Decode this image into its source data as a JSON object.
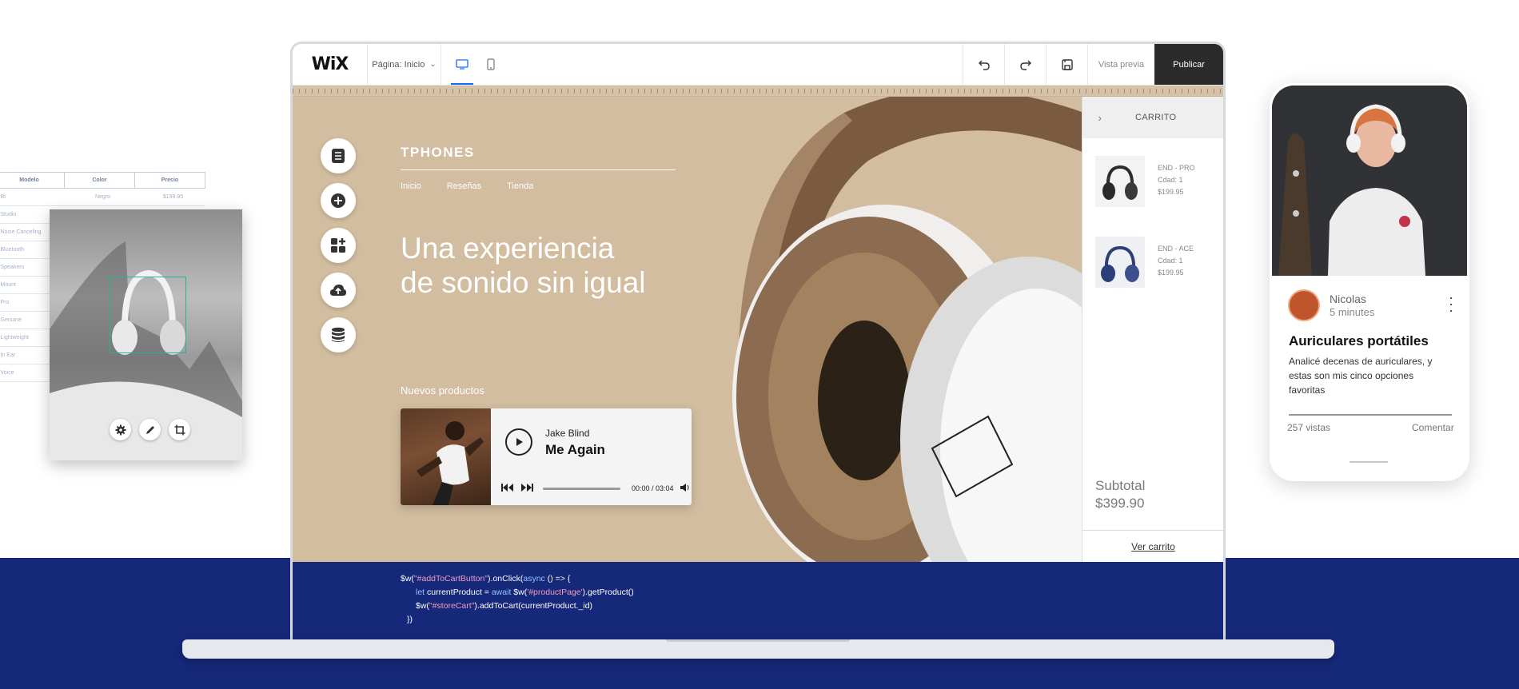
{
  "editor": {
    "logo": "WiX",
    "page_selector": "Página: Inicio",
    "preview_label": "Vista previa",
    "publish_label": "Publicar"
  },
  "site": {
    "brand": "TPHONES",
    "nav": [
      "Inicio",
      "Reseñas",
      "Tienda"
    ],
    "hero_line1": "Una experiencia",
    "hero_line2": "de sonido sin igual",
    "products_heading": "Nuevos productos"
  },
  "player": {
    "artist": "Jake Blind",
    "track": "Me Again",
    "time": "00:00 / 03:04",
    "progress": 0
  },
  "cart": {
    "title": "CARRITO",
    "items": [
      {
        "name": "END - PRO",
        "qty": "Cdad: 1",
        "price": "$199.95"
      },
      {
        "name": "END - ACE",
        "qty": "Cdad: 1",
        "price": "$199.95"
      }
    ],
    "subtotal_label": "Subtotal",
    "subtotal_value": "$399.90",
    "view_cart": "Ver carrito"
  },
  "code": {
    "l1a": "$w(",
    "l1s": "\"#addToCartButton\"",
    "l1b": ").onClick(",
    "l1k": "async",
    "l1c": " () => {",
    "l2k1": "let",
    "l2a": " currentProduct = ",
    "l2k2": "await",
    "l2b": " $w(",
    "l2s": "'#productPage'",
    "l2c": ").getProduct()",
    "l3a": "$w(",
    "l3s": "\"#storeCart\"",
    "l3b": ").addToCart(currentProduct._id)",
    "l4": "})"
  },
  "table": {
    "headers": [
      "Modelo",
      "Color",
      "Precio"
    ],
    "row1": [
      "Bt",
      "Negro",
      "$199.95"
    ],
    "models": [
      "Studio",
      "Noise Canceling",
      "Bluetooth",
      "Speakers",
      "Mount",
      "Pro",
      "Genuine",
      "Lightweight",
      "In Ear",
      "Voice"
    ]
  },
  "blog": {
    "author": "Nicolas",
    "time": "5 minutes",
    "title": "Auriculares portátiles",
    "body": "Analicé decenas de auriculares, y estas son mis cinco opciones favoritas",
    "views": "257 vistas",
    "comment": "Comentar"
  },
  "colors": {
    "navy": "#16287a",
    "canvas_tan": "#d2bda0",
    "publish_bg": "#2b2b2b",
    "accent_blue": "#116dff"
  }
}
